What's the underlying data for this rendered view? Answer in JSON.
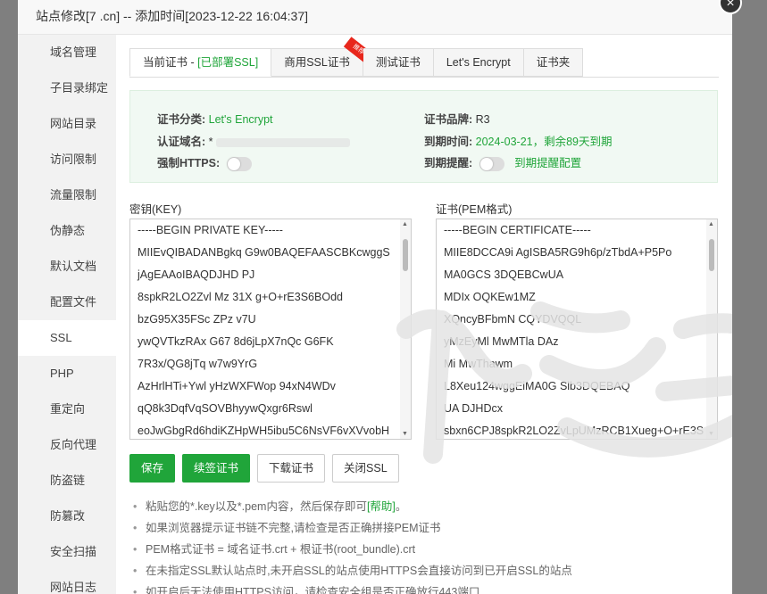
{
  "dialog": {
    "title": "站点修改[7      .cn] -- 添加时间[2023-12-22 16:04:37]",
    "close_glyph": "×"
  },
  "sidebar": {
    "items": [
      {
        "label": "域名管理"
      },
      {
        "label": "子目录绑定"
      },
      {
        "label": "网站目录"
      },
      {
        "label": "访问限制"
      },
      {
        "label": "流量限制"
      },
      {
        "label": "伪静态"
      },
      {
        "label": "默认文档"
      },
      {
        "label": "配置文件"
      },
      {
        "label": "SSL"
      },
      {
        "label": "PHP"
      },
      {
        "label": "重定向"
      },
      {
        "label": "反向代理"
      },
      {
        "label": "防盗链"
      },
      {
        "label": "防篡改"
      },
      {
        "label": "安全扫描"
      },
      {
        "label": "网站日志"
      }
    ],
    "active": "SSL"
  },
  "tabs": {
    "current_prefix": "当前证书 - ",
    "current_status": "[已部署SSL]",
    "commercial": "商用SSL证书",
    "commercial_badge": "推荐",
    "test": "测试证书",
    "letsencrypt": "Let's Encrypt",
    "folder": "证书夹"
  },
  "info": {
    "category_label": "证书分类:",
    "category_value": "Let's Encrypt",
    "brand_label": "证书品牌:",
    "brand_value": "R3",
    "domain_label": "认证域名:",
    "domain_value": "*",
    "expiry_label": "到期时间:",
    "expiry_value": "2024-03-21，剩余89天到期",
    "https_label": "强制HTTPS:",
    "reminder_label": "到期提醒:",
    "reminder_link": "到期提醒配置"
  },
  "key": {
    "label": "密钥(KEY)",
    "lines": [
      "-----BEGIN PRIVATE KEY-----",
      "MIIEvQIBADANBgkq    G9w0BAQEFAASCBKcwggS",
      "jAgEAAoIBAQDJHD         PJ",
      "8spkR2LO2Zvl    Mz    31X    g+O+rE3S6BOdd",
      "bzG95X35FSc    ZPz       v7U",
      "ywQVTkzRAx    G67    8d6jLpX7nQc        G6FK",
      "7R3x/QG8jTq          w7w9YrG",
      "AzHrlHTi+Ywl     yHzWXFWop    94xN4WDv",
      "qQ8k3DqfVqSOVBhyywQxgr6Rswl",
      "eoJwGbgRd6hdiKZHpWH5ibu5C6NsVF6vXVvobH"
    ]
  },
  "cert": {
    "label": "证书(PEM格式)",
    "lines": [
      "-----BEGIN CERTIFICATE-----",
      "MIIE8DCCA9i    AgISBA5RG9h6p/zTbdA+P5Po",
      "     MA0GCS     3DQEBCwUA",
      "MDIx          OQKEw1MZ",
      "XQncyBFbmN          CQYDVQQL",
      "      yMzEyMl        MwMTla       DAz",
      "Mi        MwThawm",
      "       L8Xeu124wggEiMA0G       Slb3DQEBAQ",
      "UA                     DJHDcx",
      "sbxn6CPJ8spkR2LO2ZvLpUMzRCB1Xueg+O+rE3S"
    ]
  },
  "buttons": {
    "save": "保存",
    "renew": "续签证书",
    "download": "下载证书",
    "close_ssl": "关闭SSL"
  },
  "tips": [
    {
      "text": "粘贴您的*.key以及*.pem内容，然后保存即可",
      "link": "[帮助]",
      "end": "。"
    },
    {
      "text": "如果浏览器提示证书链不完整,请检查是否正确拼接PEM证书",
      "link": "",
      "end": ""
    },
    {
      "text": "PEM格式证书 = 域名证书.crt + 根证书(root_bundle).crt",
      "link": "",
      "end": ""
    },
    {
      "text": "在未指定SSL默认站点时,未开启SSL的站点使用HTTPS会直接访问到已开启SSL的站点",
      "link": "",
      "end": ""
    },
    {
      "text": "如开启后无法使用HTTPS访问，请检查安全组是否正确放行443端口",
      "link": "",
      "end": ""
    }
  ],
  "colors": {
    "accent": "#20a53a",
    "badge": "#e8271c"
  },
  "toggles": {
    "force_https": false,
    "expiry_reminder": false
  }
}
